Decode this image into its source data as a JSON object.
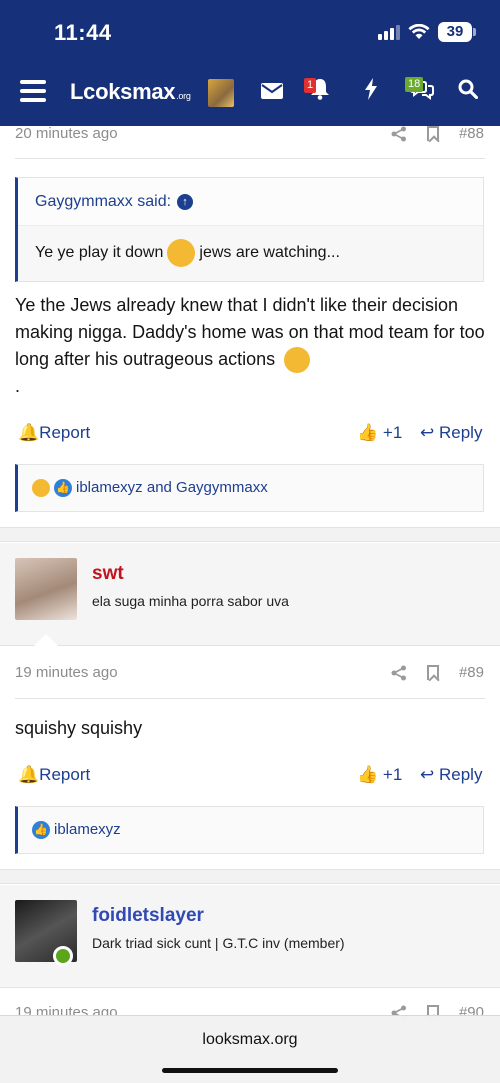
{
  "status": {
    "time": "11:44",
    "battery": "39"
  },
  "nav": {
    "logo": "Lcoksmax",
    "logo_suffix": ".org",
    "notifications_badge": "1",
    "conversations_badge": "18"
  },
  "post88": {
    "time": "20 minutes ago",
    "number": "#88",
    "quote_author": "Gaygymmaxx said:",
    "quote_text_before": "Ye ye play it down",
    "quote_text_after": "jews are watching...",
    "body": "Ye the Jews already knew that I didn't like their decision making nigga. Daddy's home was on that mod team for too long after his outrageous actions",
    "body_tail": ".",
    "report_label": "Report",
    "like_label": "+1",
    "reply_label": "Reply",
    "reactions": "iblamexyz and Gaygymmaxx"
  },
  "post89": {
    "username": "swt",
    "user_title": "ela suga minha porra sabor uva",
    "time": "19 minutes ago",
    "number": "#89",
    "body": "squishy squishy",
    "report_label": "Report",
    "like_label": "+1",
    "reply_label": "Reply",
    "reactions": "iblamexyz"
  },
  "post90": {
    "username": "foidletslayer",
    "user_title": "Dark triad sick cunt | G.T.C inv (member)",
    "time": "19 minutes ago",
    "number": "#90"
  },
  "browser": {
    "address": "looksmax.org"
  },
  "colors": {
    "nav_bg": "#16307a",
    "link": "#1d3f8f",
    "username_red": "#c0141f",
    "username_blue": "#3049b3",
    "online": "#5aa51b"
  }
}
